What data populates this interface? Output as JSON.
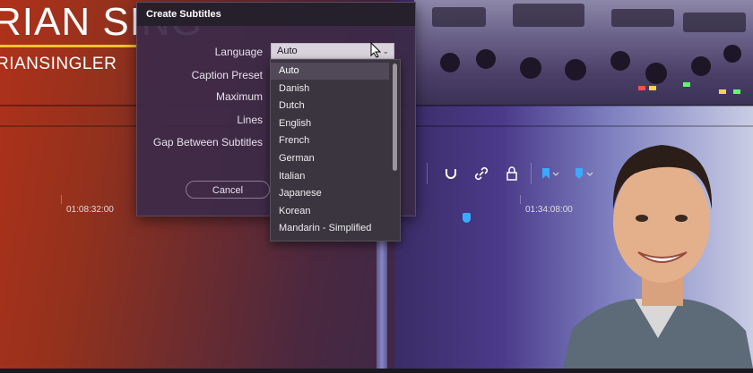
{
  "banner": {
    "name": "RIAN SING",
    "handle": "RIANSINGLER"
  },
  "timeline": {
    "timecode_left": "01:08:32:00",
    "timecode_right": "01:34:08:00"
  },
  "dialog": {
    "title": "Create Subtitles",
    "labels": {
      "language": "Language",
      "caption_preset": "Caption Preset",
      "maximum": "Maximum",
      "lines": "Lines",
      "gap": "Gap Between Subtitles"
    },
    "cancel_label": "Cancel",
    "language_select": {
      "value": "Auto",
      "chevron": "⌄"
    },
    "language_options": [
      "Auto",
      "Danish",
      "Dutch",
      "English",
      "French",
      "German",
      "Italian",
      "Japanese",
      "Korean",
      "Mandarin - Simplified"
    ],
    "selected_option_index": 0
  },
  "toolbar_icons": [
    "magnet-icon",
    "link-icon",
    "lock-icon",
    "flag-icon",
    "marker-icon"
  ],
  "colors": {
    "accent_blue": "#3da8ff",
    "banner_underline": "#f2c233",
    "dialog_bg": "#3c2a48",
    "dropdown_selected": "#514958"
  }
}
